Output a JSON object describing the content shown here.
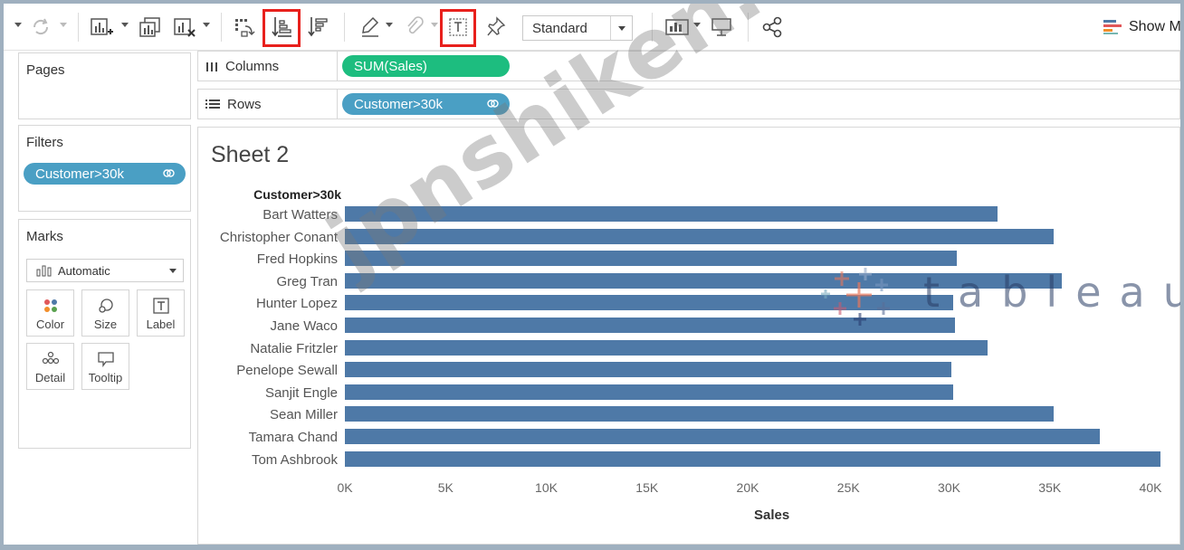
{
  "toolbar": {
    "mark_size_option": "Standard",
    "show_me_label": "Show M",
    "icons": [
      "refresh-icon",
      "new-worksheet-icon",
      "duplicate-icon",
      "clear-sheet-icon",
      "swap-icon",
      "sort-ascending-icon",
      "sort-descending-icon",
      "highlight-icon",
      "group-icon",
      "show-mark-labels-icon",
      "pin-icon",
      "presentation-icon",
      "share-icon"
    ]
  },
  "panels": {
    "pages_title": "Pages",
    "filters_title": "Filters",
    "filter_pill": "Customer>30k",
    "marks_title": "Marks",
    "mark_type": "Automatic",
    "mark_buttons": [
      "Color",
      "Size",
      "Label",
      "Detail",
      "Tooltip"
    ]
  },
  "shelves": {
    "columns_label": "Columns",
    "columns_pill": "SUM(Sales)",
    "rows_label": "Rows",
    "rows_pill": "Customer>30k"
  },
  "sheet": {
    "title": "Sheet 2",
    "row_header": "Customer>30k"
  },
  "chart_data": {
    "type": "bar",
    "orientation": "horizontal",
    "categories": [
      "Bart Watters",
      "Christopher Conant",
      "Fred Hopkins",
      "Greg Tran",
      "Hunter Lopez",
      "Jane Waco",
      "Natalie Fritzler",
      "Penelope Sewall",
      "Sanjit Engle",
      "Sean Miller",
      "Tamara Chand",
      "Tom Ashbrook"
    ],
    "values": [
      32400,
      35200,
      30400,
      35600,
      30200,
      30300,
      31900,
      30100,
      30200,
      35200,
      37500,
      40500
    ],
    "xlabel": "Sales",
    "ylabel": "Customer>30k",
    "xlim": [
      0,
      40000
    ],
    "ticks": [
      "0K",
      "5K",
      "10K",
      "15K",
      "20K",
      "25K",
      "30K",
      "35K",
      "40K"
    ],
    "bar_color": "#4e79a7",
    "grid": false
  },
  "overlays": {
    "watermark": "jpnshiken.com",
    "logo_text": "tableau"
  },
  "colors": {
    "pill_blue": "#4a9fc4",
    "pill_green": "#1dbd7f",
    "highlight_box": "#e8201c"
  }
}
